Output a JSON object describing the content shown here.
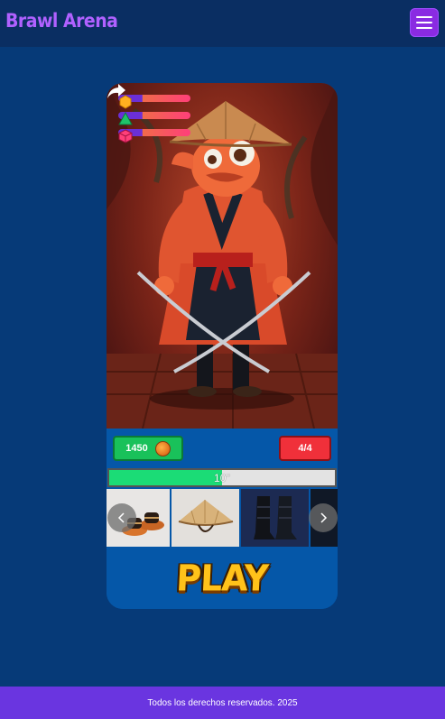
{
  "header": {
    "brand": "Brawl Arena",
    "menu_icon": "hamburger-icon",
    "menu_color": "#8a2be2",
    "brand_color": "#b061ff"
  },
  "character": {
    "image": "samurai-fish-character",
    "stats": [
      {
        "icon": "hexagon-coin-icon",
        "color": "#ffb020"
      },
      {
        "icon": "green-pyramid-icon",
        "color": "#1fc26a"
      },
      {
        "icon": "red-cube-icon",
        "color": "#ff3f7a"
      }
    ],
    "share_icon": "share-arrow-icon"
  },
  "resources": {
    "coins": "1450",
    "coin_icon": "coin-icon",
    "lives": "4/4"
  },
  "timer": {
    "label": "10''",
    "fraction": 0.5
  },
  "items": [
    {
      "name": "sandals",
      "icon": "sandals-icon"
    },
    {
      "name": "straw-hat",
      "icon": "straw-hat-icon"
    },
    {
      "name": "black-boots",
      "icon": "boots-icon"
    }
  ],
  "carousel": {
    "prev_icon": "chevron-left-icon",
    "next_icon": "chevron-right-icon"
  },
  "play": {
    "label": "PLAY"
  },
  "footer": {
    "text": "Todos los derechos reservados. 2025"
  },
  "colors": {
    "background": "#063a78",
    "card": "#0557a8",
    "coins_badge": "#19c15a",
    "lives_badge": "#f0303a",
    "timer_fill": "#1bdc76",
    "footer": "#6a35e0"
  }
}
